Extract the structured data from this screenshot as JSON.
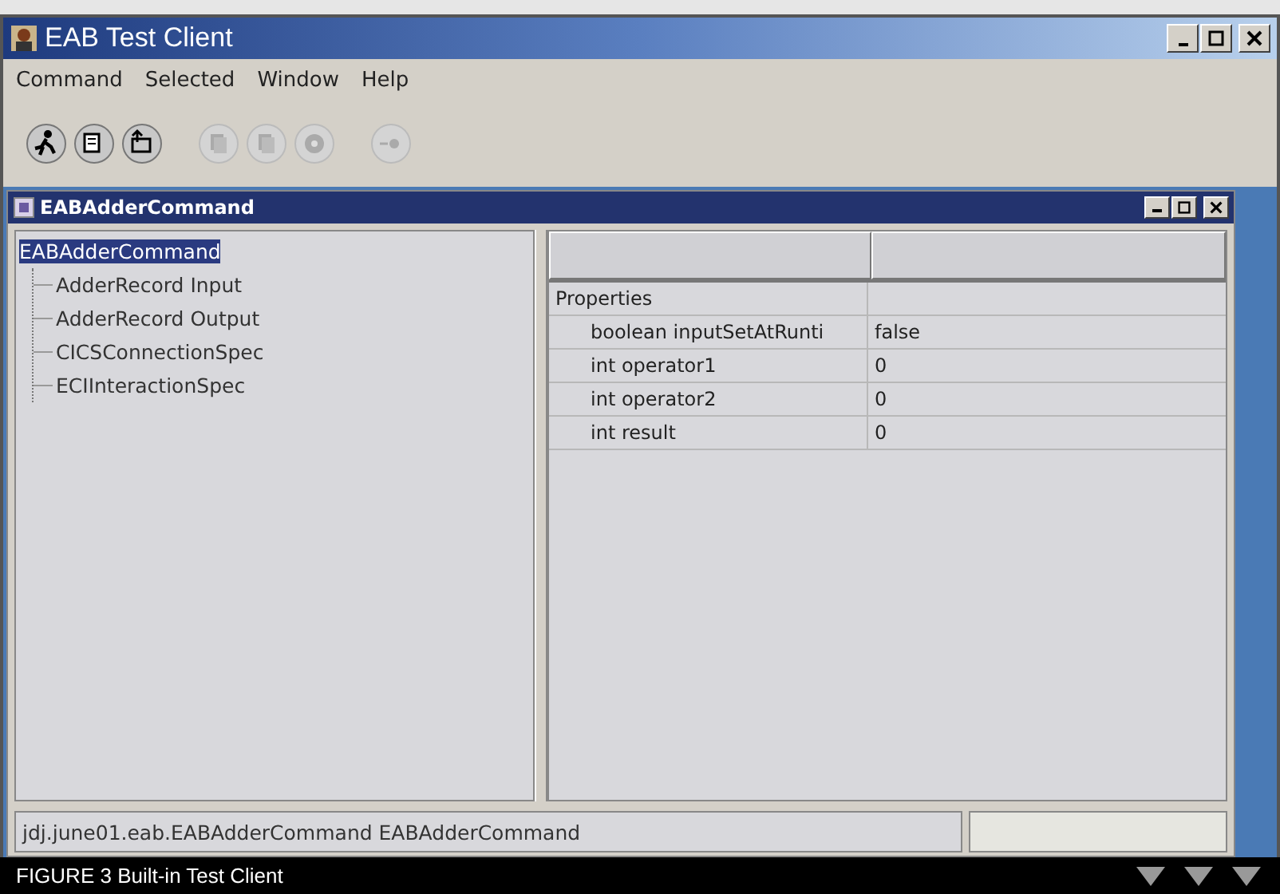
{
  "window": {
    "title": "EAB Test Client"
  },
  "menu": [
    "Command",
    "Selected",
    "Window",
    "Help"
  ],
  "toolbar": [
    {
      "kind": "runner",
      "disabled": false
    },
    {
      "kind": "record",
      "disabled": false
    },
    {
      "kind": "upload",
      "disabled": false
    },
    {
      "kind": "copy",
      "disabled": true
    },
    {
      "kind": "copy",
      "disabled": true
    },
    {
      "kind": "disc",
      "disabled": true
    },
    {
      "kind": "target",
      "disabled": true
    }
  ],
  "internal_frame": {
    "title": "EABAdderCommand"
  },
  "tree": {
    "items": [
      {
        "label": "EABAdderCommand",
        "selected": true,
        "children": [
          {
            "label": "AdderRecord Input",
            "selected": false
          },
          {
            "label": "AdderRecord Output",
            "selected": false
          },
          {
            "label": "CICSConnectionSpec",
            "selected": false
          },
          {
            "label": "ECIInteractionSpec",
            "selected": false
          }
        ]
      }
    ]
  },
  "properties": {
    "rows": [
      {
        "name": "Properties",
        "children": [
          {
            "name": "boolean inputSetAtRunti",
            "value": "false"
          },
          {
            "name": "int operator1",
            "value": "0"
          },
          {
            "name": "int operator2",
            "value": "0"
          },
          {
            "name": "int result",
            "value": "0"
          }
        ]
      }
    ]
  },
  "status_bar": {
    "text": "jdj.june01.eab.EABAdderCommand EABAdderCommand"
  },
  "caption": {
    "text": "FIGURE 3 Built-in Test Client"
  }
}
